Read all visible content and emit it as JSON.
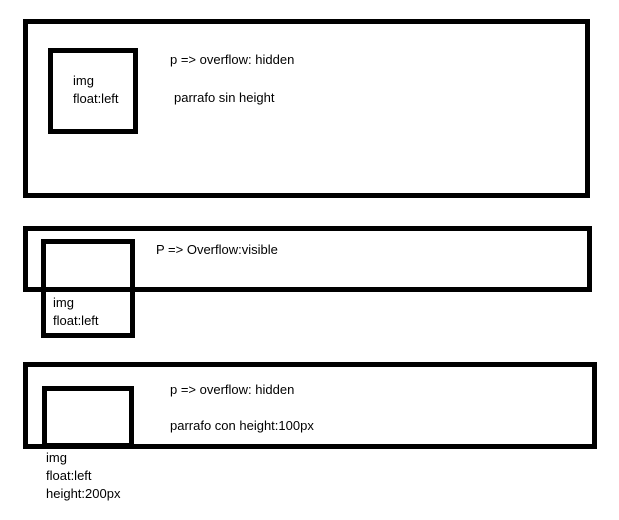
{
  "panel1": {
    "img_label_line1": "img",
    "img_label_line2": "float:left",
    "rule": "p => overflow: hidden",
    "description": "parrafo sin height"
  },
  "panel2": {
    "img_label_line1": "img",
    "img_label_line2": "float:left",
    "rule": "P => Overflow:visible"
  },
  "panel3": {
    "img_label_line1": "img",
    "img_label_line2": "float:left",
    "img_label_line3": "height:200px",
    "rule": "p => overflow: hidden",
    "description": "parrafo con height:100px"
  }
}
